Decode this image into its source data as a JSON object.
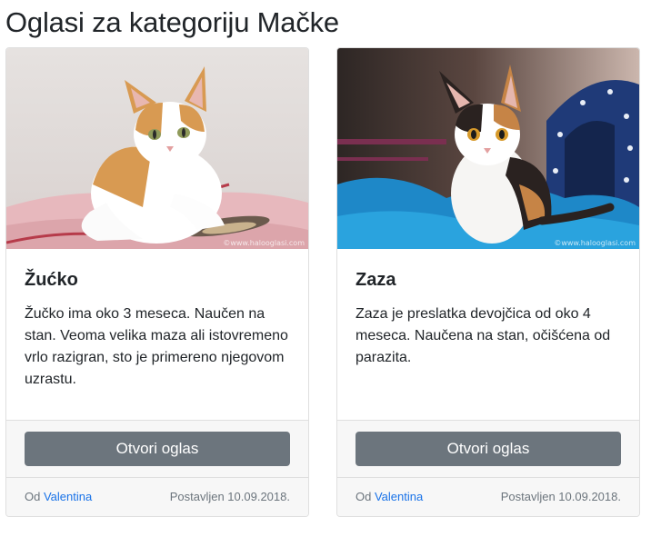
{
  "page": {
    "title": "Oglasi za kategoriju Mačke"
  },
  "ads": [
    {
      "title": "Žućko",
      "description": "Žučko ima oko 3 meseca. Naučen na stan. Veoma velika maza ali istovremeno vrlo razigran, sto je primereno njegovom uzrastu.",
      "button_label": "Otvori oglas",
      "by_label": "Od",
      "author": "Valentina",
      "posted": "Postavljen 10.09.2018.",
      "image_watermark": "©www.halooglasi.com"
    },
    {
      "title": "Zaza",
      "description": "Zaza je preslatka devojčica od oko 4 meseca. Naučena na stan, očišćena od parazita.",
      "button_label": "Otvori oglas",
      "by_label": "Od",
      "author": "Valentina",
      "posted": "Postavljen 10.09.2018.",
      "image_watermark": "©www.halooglasi.com"
    }
  ],
  "colors": {
    "button_bg": "#6c757d",
    "link": "#1a73e8",
    "card_border": "#dfdfdf",
    "footer_bg": "#f7f7f7"
  }
}
